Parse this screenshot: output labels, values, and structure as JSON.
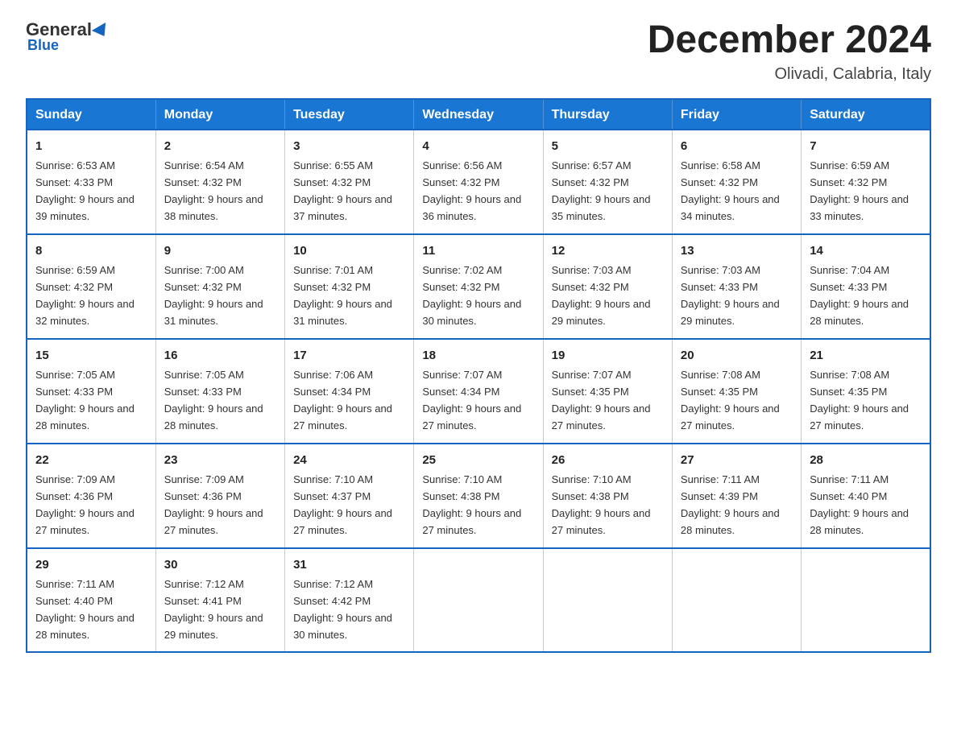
{
  "logo": {
    "general": "General",
    "blue": "Blue"
  },
  "title": "December 2024",
  "subtitle": "Olivadi, Calabria, Italy",
  "days_header": [
    "Sunday",
    "Monday",
    "Tuesday",
    "Wednesday",
    "Thursday",
    "Friday",
    "Saturday"
  ],
  "weeks": [
    [
      {
        "day": "1",
        "sunrise": "6:53 AM",
        "sunset": "4:33 PM",
        "daylight": "9 hours and 39 minutes."
      },
      {
        "day": "2",
        "sunrise": "6:54 AM",
        "sunset": "4:32 PM",
        "daylight": "9 hours and 38 minutes."
      },
      {
        "day": "3",
        "sunrise": "6:55 AM",
        "sunset": "4:32 PM",
        "daylight": "9 hours and 37 minutes."
      },
      {
        "day": "4",
        "sunrise": "6:56 AM",
        "sunset": "4:32 PM",
        "daylight": "9 hours and 36 minutes."
      },
      {
        "day": "5",
        "sunrise": "6:57 AM",
        "sunset": "4:32 PM",
        "daylight": "9 hours and 35 minutes."
      },
      {
        "day": "6",
        "sunrise": "6:58 AM",
        "sunset": "4:32 PM",
        "daylight": "9 hours and 34 minutes."
      },
      {
        "day": "7",
        "sunrise": "6:59 AM",
        "sunset": "4:32 PM",
        "daylight": "9 hours and 33 minutes."
      }
    ],
    [
      {
        "day": "8",
        "sunrise": "6:59 AM",
        "sunset": "4:32 PM",
        "daylight": "9 hours and 32 minutes."
      },
      {
        "day": "9",
        "sunrise": "7:00 AM",
        "sunset": "4:32 PM",
        "daylight": "9 hours and 31 minutes."
      },
      {
        "day": "10",
        "sunrise": "7:01 AM",
        "sunset": "4:32 PM",
        "daylight": "9 hours and 31 minutes."
      },
      {
        "day": "11",
        "sunrise": "7:02 AM",
        "sunset": "4:32 PM",
        "daylight": "9 hours and 30 minutes."
      },
      {
        "day": "12",
        "sunrise": "7:03 AM",
        "sunset": "4:32 PM",
        "daylight": "9 hours and 29 minutes."
      },
      {
        "day": "13",
        "sunrise": "7:03 AM",
        "sunset": "4:33 PM",
        "daylight": "9 hours and 29 minutes."
      },
      {
        "day": "14",
        "sunrise": "7:04 AM",
        "sunset": "4:33 PM",
        "daylight": "9 hours and 28 minutes."
      }
    ],
    [
      {
        "day": "15",
        "sunrise": "7:05 AM",
        "sunset": "4:33 PM",
        "daylight": "9 hours and 28 minutes."
      },
      {
        "day": "16",
        "sunrise": "7:05 AM",
        "sunset": "4:33 PM",
        "daylight": "9 hours and 28 minutes."
      },
      {
        "day": "17",
        "sunrise": "7:06 AM",
        "sunset": "4:34 PM",
        "daylight": "9 hours and 27 minutes."
      },
      {
        "day": "18",
        "sunrise": "7:07 AM",
        "sunset": "4:34 PM",
        "daylight": "9 hours and 27 minutes."
      },
      {
        "day": "19",
        "sunrise": "7:07 AM",
        "sunset": "4:35 PM",
        "daylight": "9 hours and 27 minutes."
      },
      {
        "day": "20",
        "sunrise": "7:08 AM",
        "sunset": "4:35 PM",
        "daylight": "9 hours and 27 minutes."
      },
      {
        "day": "21",
        "sunrise": "7:08 AM",
        "sunset": "4:35 PM",
        "daylight": "9 hours and 27 minutes."
      }
    ],
    [
      {
        "day": "22",
        "sunrise": "7:09 AM",
        "sunset": "4:36 PM",
        "daylight": "9 hours and 27 minutes."
      },
      {
        "day": "23",
        "sunrise": "7:09 AM",
        "sunset": "4:36 PM",
        "daylight": "9 hours and 27 minutes."
      },
      {
        "day": "24",
        "sunrise": "7:10 AM",
        "sunset": "4:37 PM",
        "daylight": "9 hours and 27 minutes."
      },
      {
        "day": "25",
        "sunrise": "7:10 AM",
        "sunset": "4:38 PM",
        "daylight": "9 hours and 27 minutes."
      },
      {
        "day": "26",
        "sunrise": "7:10 AM",
        "sunset": "4:38 PM",
        "daylight": "9 hours and 27 minutes."
      },
      {
        "day": "27",
        "sunrise": "7:11 AM",
        "sunset": "4:39 PM",
        "daylight": "9 hours and 28 minutes."
      },
      {
        "day": "28",
        "sunrise": "7:11 AM",
        "sunset": "4:40 PM",
        "daylight": "9 hours and 28 minutes."
      }
    ],
    [
      {
        "day": "29",
        "sunrise": "7:11 AM",
        "sunset": "4:40 PM",
        "daylight": "9 hours and 28 minutes."
      },
      {
        "day": "30",
        "sunrise": "7:12 AM",
        "sunset": "4:41 PM",
        "daylight": "9 hours and 29 minutes."
      },
      {
        "day": "31",
        "sunrise": "7:12 AM",
        "sunset": "4:42 PM",
        "daylight": "9 hours and 30 minutes."
      },
      null,
      null,
      null,
      null
    ]
  ]
}
